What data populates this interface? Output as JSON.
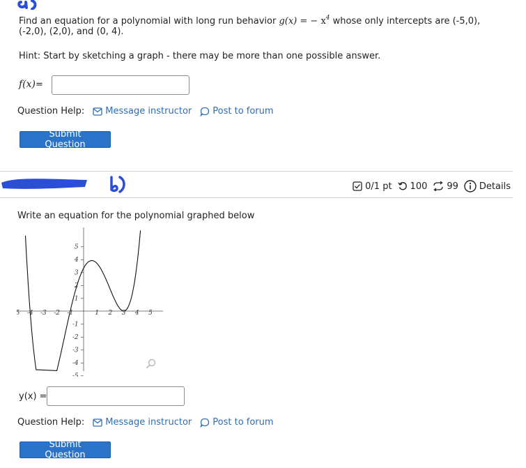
{
  "part_a": {
    "scribble_label": "a)",
    "question_line1_pre": "Find an equation for a polynomial with long run behavior ",
    "g_lhs": "g(x)",
    "g_eq": " = ",
    "g_rhs_sign": "− x",
    "g_rhs_exp": "4",
    "question_line1_post": " whose only intercepts are (-5,0),",
    "question_line2": "(-2,0), (2,0), and (0, 4).",
    "hint": "Hint: Start by sketching a graph - there may be more than one possible answer.",
    "answer_label_fn": "f(x)",
    "answer_label_eq": " =",
    "answer_value": "",
    "help_label": "Question Help:",
    "message_link": "Message instructor",
    "forum_link": "Post to forum",
    "submit_label": "Submit Question"
  },
  "part_b": {
    "scribble_label": "b)",
    "score": "0/1 pt",
    "attempts": "100",
    "retries": "99",
    "details": "Details",
    "question": "Write an equation for the polynomial graphed below",
    "answer_label": "y(x) =",
    "answer_value": "",
    "help_label": "Question Help:",
    "message_link": "Message instructor",
    "forum_link": "Post to forum",
    "submit_label": "Submit Question"
  },
  "graph": {
    "x_ticks": [
      "-5",
      "-4",
      "-3",
      "-2",
      "-1",
      "1",
      "2",
      "3",
      "4",
      "5"
    ],
    "y_ticks": [
      "5",
      "4",
      "3",
      "2",
      "1",
      "-1",
      "-2",
      "-3",
      "-4",
      "-5"
    ],
    "zoom_icon": "magnifier-icon"
  },
  "colors": {
    "link": "#2e6db4",
    "button": "#2a73c9",
    "scribble": "#2a4fd6"
  }
}
